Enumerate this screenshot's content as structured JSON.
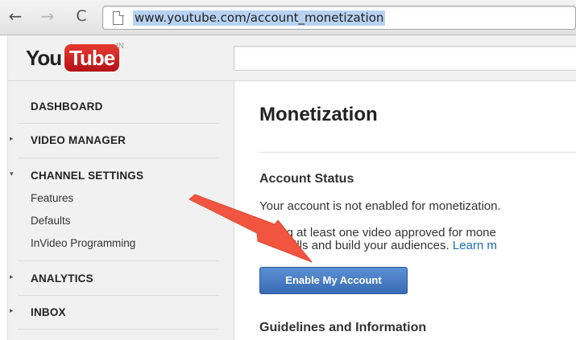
{
  "browser": {
    "url": "www.youtube.com/account_monetization",
    "back_glyph": "←",
    "forward_glyph": "→",
    "reload_glyph": "C"
  },
  "header": {
    "logo_you": "You",
    "logo_tube": "Tube",
    "logo_region": "IN"
  },
  "sidebar": {
    "dashboard": "DASHBOARD",
    "video_manager": "VIDEO MANAGER",
    "channel_settings": "CHANNEL SETTINGS",
    "features": "Features",
    "defaults": "Defaults",
    "invideo": "InVideo Programming",
    "analytics": "ANALYTICS",
    "inbox": "INBOX",
    "caret_collapsed": "▸",
    "caret_expanded": "▾"
  },
  "main": {
    "title": "Monetization",
    "account_status_heading": "Account Status",
    "status_text": "Your account is not enabled for monetization.",
    "promo_line1": "ing at least one video approved for mone",
    "promo_line2": "skills and build your audiences.",
    "learn_more": "Learn m",
    "enable_button": "Enable My Account",
    "guidelines_heading": "Guidelines and Information"
  },
  "colors": {
    "arrow": "#f1543f",
    "button": "#3a6cb4",
    "link": "#1a6dba",
    "url_highlight": "#b8d2f2"
  },
  "icons": {
    "page": "page-icon",
    "arrow": "red-arrow-pointer"
  }
}
